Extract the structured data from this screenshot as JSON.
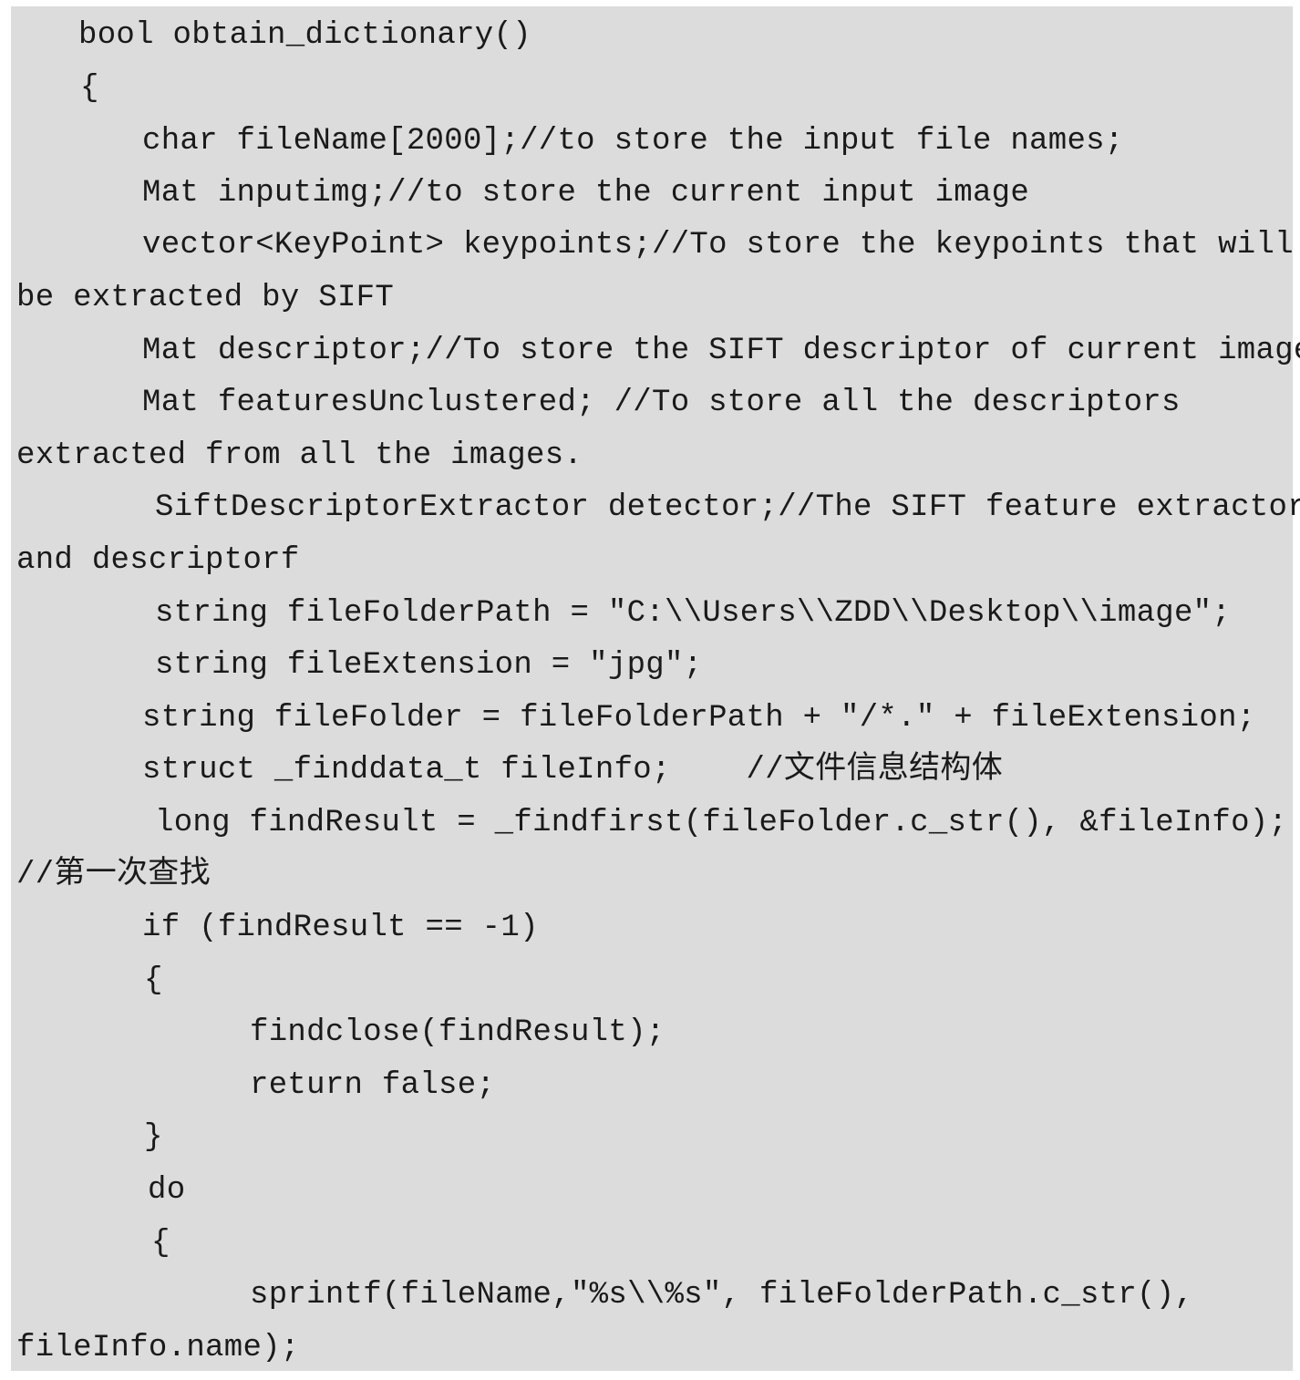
{
  "code": {
    "lines": [
      "bool obtain_dictionary()",
      "{",
      "char fileName[2000];//to store the input file names;",
      "Mat inputimg;//to store the current input image",
      "vector<KeyPoint> keypoints;//To store the keypoints that will",
      "be extracted by SIFT",
      "Mat descriptor;//To store the SIFT descriptor of current image",
      "Mat featuresUnclustered; //To store all the descriptors",
      "extracted from all the images.",
      "SiftDescriptorExtractor detector;//The SIFT feature extractor",
      "and descriptorf",
      "string fileFolderPath = \"C:\\\\Users\\\\ZDD\\\\Desktop\\\\image\";",
      "string fileExtension = \"jpg\";",
      "string fileFolder = fileFolderPath + \"/*.\" + fileExtension;",
      "struct _finddata_t fileInfo;    //文件信息结构体",
      "long findResult = _findfirst(fileFolder.c_str(), &fileInfo);",
      "//第一次查找",
      "if (findResult == -1)",
      "{",
      "findclose(findResult);",
      "return false;",
      "}",
      "do",
      "{",
      "sprintf(fileName,\"%s\\\\%s\", fileFolderPath.c_str(),",
      "fileInfo.name);"
    ]
  }
}
